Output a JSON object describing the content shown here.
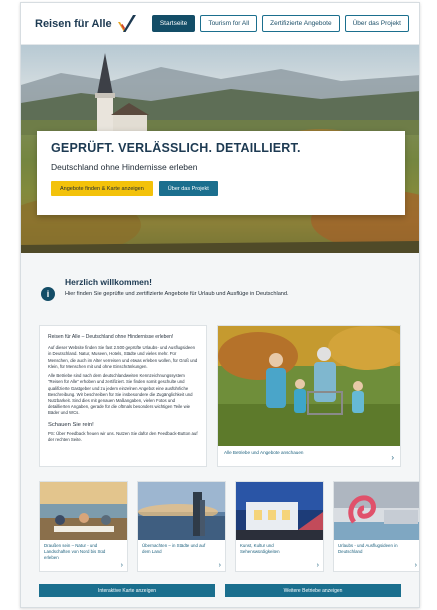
{
  "header": {
    "logo_text": "Reisen für Alle",
    "nav": [
      {
        "label": "Startseite",
        "active": true
      },
      {
        "label": "Tourism for All",
        "active": false
      },
      {
        "label": "Zertifizierte Angebote",
        "active": false
      },
      {
        "label": "Über das Projekt",
        "active": false
      }
    ]
  },
  "hero": {
    "title": "GEPRÜFT. VERLÄSSLICH. DETAILLIERT.",
    "subtitle": "Deutschland ohne Hindernisse erleben",
    "btn_primary": "Angebote finden & Karte anzeigen",
    "btn_secondary": "Über das Projekt"
  },
  "welcome": {
    "icon": "info-icon",
    "title": "Herzlich willkommen!",
    "text": "Hier finden Sie geprüfte und zertifizierte Angebote für Urlaub und Ausflüge in Deutschland."
  },
  "intro": {
    "head": "Reisen für Alle – Deutschland ohne Hindernisse erleben!",
    "p1": "Auf dieser Website finden Sie fast 2.500 geprüfte Urlaubs- und Ausflugsideen in Deutschland. Natur, Museen, Hotels, Städte und vieles mehr. Für Menschen, die auch im Alter verreisen und etwas erleben wollen, für Groß und Klein, für Menschen mit und ohne Einschränkungen.",
    "p2": "Alle Betriebe sind nach dem deutschlandweiten Kennzeichnungssystem \"Reisen für Alle\" erhoben und zertifiziert. Sie finden somit geschulte und qualifizierte Gastgeber und zu jedem einzelnen Angebot eine ausführliche Beschreibung. Wir beschreiben für Sie insbesondere die Zugänglichkeit und Nutzbarkeit. Sind dies mit genauen Maßangaben, vielen Fotos und detaillierten Angaben, gerade für die oftmals besonders wichtigen Teile wie Bäder und WCs.",
    "strong": "Schauen Sie rein!",
    "ps": "PS: Über Feedback freuen wir uns. Nutzen Sie dafür den Feedback-Button auf der rechten Seite."
  },
  "feature": {
    "caption": "Alle Betriebe und Angebote anschauen"
  },
  "cards": [
    {
      "caption": "Draußen sein – Natur - und Landschaften von Nord bis Süd erleben"
    },
    {
      "caption": "Übernachten – in Städte und auf dem Land"
    },
    {
      "caption": "Kunst, Kultur und Sehenswürdigkeiten"
    },
    {
      "caption": "Urlaubs - und Ausflugsideen in Deutschland"
    }
  ],
  "actions": {
    "left": "Interaktive Karte anzeigen",
    "right": "Weitere Betriebe anzeigen"
  },
  "colors": {
    "brand_dark": "#134d67",
    "brand_teal": "#1b6f8e",
    "accent_yellow": "#f3c20b"
  }
}
